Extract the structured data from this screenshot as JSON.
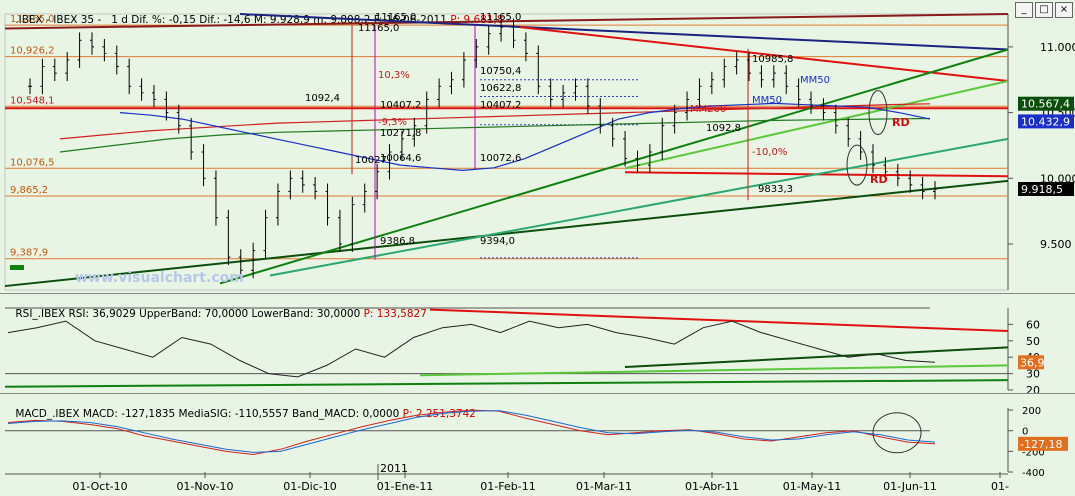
{
  "header": {
    "main": {
      "text": ".IBEX - IBEX 35 -   1 d Dif. %: -0,15 Dif.: -14,6 M: 9.928,9 m: 9.808,2 F: 16-06-2011 ",
      "highlight": "P: 9.681,8"
    },
    "rsi": {
      "text": "RSI_.IBEX RSI: 36,9029 UpperBand: 70,0000 LowerBand: 30,0000 ",
      "highlight": "P: 133,5827"
    },
    "macd": {
      "text": "MACD_.IBEX MACD: -127,1835 MediaSIG: -110,5557 Band_MACD: 0,0000 ",
      "highlight": "P: 2.251,3742"
    }
  },
  "window_buttons": [
    "_",
    "□",
    "×"
  ],
  "watermark": "www.visualchart.com",
  "colors": {
    "bg": "#e8f4e4",
    "price": "#000000",
    "mm50": "#1a2fc8",
    "mm200": "#d02020",
    "green_line": "#1d9a1d",
    "dark_line": "#0b4d0b",
    "level": "#e07a30",
    "dark_red": "#8b1a1a",
    "navy": "#1a237e",
    "magenta": "#c000c0"
  },
  "chart_data": [
    {
      "type": "candlestick",
      "title": ".IBEX - IBEX 35 - 1 d",
      "x": [
        "01-Oct-10",
        "01-Nov-10",
        "01-Dic-10",
        "01-Ene-11",
        "01-Feb-11",
        "01-Mar-11",
        "01-Abr-11",
        "01-May-11",
        "01-Jun-11",
        "01-"
      ],
      "x_year_marker": "2011",
      "ylim": [
        9150,
        11250
      ],
      "y_ticks": [
        "11.000",
        "10.500",
        "10.000",
        "9.500"
      ],
      "last_close": 9918.5,
      "close_series": [
        10700,
        10850,
        10800,
        10900,
        11050,
        11000,
        10950,
        10850,
        10700,
        10650,
        10600,
        10500,
        10400,
        10200,
        10000,
        9700,
        9400,
        9300,
        9450,
        9700,
        9900,
        10000,
        9950,
        9900,
        9700,
        9500,
        9800,
        9900,
        10050,
        10200,
        10300,
        10400,
        10600,
        10700,
        10750,
        10900,
        11000,
        11100,
        11150,
        11050,
        10950,
        10700,
        10600,
        10650,
        10700,
        10550,
        10400,
        10300,
        10150,
        10100,
        10200,
        10400,
        10500,
        10600,
        10700,
        10750,
        10850,
        10900,
        10800,
        10750,
        10800,
        10700,
        10600,
        10550,
        10500,
        10400,
        10300,
        10200,
        10100,
        10050,
        10000,
        9950,
        9900,
        9918.5
      ],
      "series": [
        {
          "name": "MM50",
          "values": [
            10500,
            10480,
            10450,
            10400,
            10350,
            10300,
            10250,
            10200,
            10150,
            10100,
            10080,
            10060,
            10080,
            10150,
            10250,
            10350,
            10450,
            10500,
            10530,
            10550,
            10560,
            10570,
            10560,
            10550,
            10540,
            10500,
            10450
          ]
        },
        {
          "name": "MM200",
          "values": [
            10300,
            10330,
            10360,
            10380,
            10400,
            10420,
            10430,
            10440,
            10450,
            10460,
            10470,
            10480,
            10490,
            10500,
            10510,
            10520,
            10530,
            10540,
            10550,
            10560,
            10567
          ]
        },
        {
          "name": "",
          "values": [
            10200,
            10250,
            10300,
            10330,
            10350,
            10360,
            10370,
            10380,
            10390,
            10400,
            10410,
            10420,
            10430,
            10440,
            10445,
            10450,
            10455
          ]
        }
      ],
      "levels": [
        {
          "label": "11,165,0",
          "value": 11165
        },
        {
          "label": "10,926,2",
          "value": 10926
        },
        {
          "label": "10,548,1",
          "value": 10548
        },
        {
          "label": "10,076,5",
          "value": 10076
        },
        {
          "label": "9,865,2",
          "value": 9865
        },
        {
          "label": "9,387,9",
          "value": 9388
        }
      ],
      "annotations": [
        "11165,0",
        "11165,0",
        "11165,0",
        "10,3%",
        "-9,3%",
        "1092,4",
        "10407,2",
        "10407,2",
        "10271,8",
        "10064,6",
        "10072,6",
        "10750,4",
        "10622,8",
        "10985,8",
        "MM50",
        "MM200",
        "MM50",
        "1092,8",
        "-10,0%",
        "9833,3",
        "RD",
        "RD",
        "9386,8",
        "9394,0",
        "10027"
      ],
      "axis_badges": [
        "10.567,4",
        "10.432,9",
        "9.918,5"
      ]
    },
    {
      "type": "line",
      "title": "RSI_.IBEX RSI",
      "ylim": [
        20,
        70
      ],
      "y_ticks": [
        "60",
        "50",
        "40",
        "30",
        "20"
      ],
      "series": [
        {
          "name": "RSI",
          "values": [
            55,
            58,
            62,
            50,
            45,
            40,
            52,
            48,
            38,
            30,
            28,
            35,
            45,
            40,
            52,
            58,
            60,
            55,
            62,
            58,
            60,
            55,
            52,
            48,
            58,
            62,
            55,
            50,
            45,
            40,
            42,
            38,
            36.9
          ]
        }
      ],
      "bands": {
        "upper": 70,
        "lower": 30
      },
      "last_value": "36,9"
    },
    {
      "type": "line",
      "title": "MACD_.IBEX MACD",
      "ylim": [
        -400,
        220
      ],
      "y_ticks": [
        "200",
        "0",
        "-200",
        "-400"
      ],
      "series": [
        {
          "name": "MACD",
          "values": [
            80,
            100,
            90,
            60,
            20,
            -50,
            -100,
            -150,
            -200,
            -230,
            -180,
            -100,
            -30,
            40,
            100,
            150,
            180,
            200,
            190,
            120,
            60,
            0,
            -40,
            -20,
            0,
            10,
            -30,
            -80,
            -100,
            -60,
            -20,
            0,
            -60,
            -110,
            -127
          ]
        },
        {
          "name": "MediaSIG",
          "values": [
            70,
            90,
            95,
            80,
            40,
            -20,
            -80,
            -130,
            -180,
            -210,
            -200,
            -130,
            -60,
            10,
            70,
            130,
            170,
            190,
            195,
            150,
            90,
            30,
            -20,
            -30,
            -10,
            5,
            -15,
            -60,
            -90,
            -80,
            -40,
            -10,
            -40,
            -90,
            -110
          ]
        }
      ],
      "band": 0,
      "last_value": "-127,18"
    }
  ]
}
